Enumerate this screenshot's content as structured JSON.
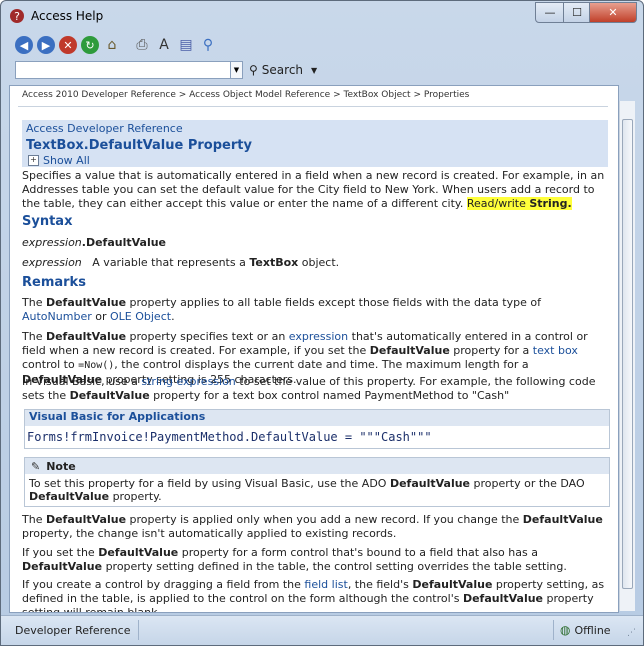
{
  "window": {
    "title": "Access Help",
    "min_glyph": "—",
    "max_glyph": "☐",
    "close_glyph": "✕"
  },
  "toolbar": {
    "buttons": [
      {
        "name": "back-button",
        "glyph": "◀",
        "color": "#3b6fc1"
      },
      {
        "name": "forward-button",
        "glyph": "▶",
        "color": "#3b6fc1"
      },
      {
        "name": "stop-button",
        "glyph": "✕",
        "color": "#c0392b"
      },
      {
        "name": "refresh-button",
        "glyph": "↻",
        "color": "#2e9b3c"
      },
      {
        "name": "home-button",
        "glyph": "⌂",
        "color": "#6a5a2e"
      },
      {
        "name": "print-button",
        "glyph": "⎙",
        "color": "#555555"
      },
      {
        "name": "font-size-button",
        "glyph": "A",
        "color": "#333333"
      },
      {
        "name": "table-of-contents-button",
        "glyph": "▤",
        "color": "#4b5fa8"
      },
      {
        "name": "pin-button",
        "glyph": "⚲",
        "color": "#3b6fc1"
      }
    ]
  },
  "search": {
    "value": "",
    "button_label": "Search"
  },
  "breadcrumb": "Access 2010 Developer Reference > Access Object Model Reference > TextBox Object > Properties",
  "header": {
    "reference": "Access Developer Reference",
    "title": "TextBox.DefaultValue Property",
    "show_all": "Show All"
  },
  "intro": {
    "text": "Specifies a value that is automatically entered in a field when a new record is created. For example, in an Addresses table you can set the default value for the City field to New York. When users add a record to the table, they can either accept this value or enter the name of a different city.",
    "rw_prefix": "Read/write",
    "rw_type": "String."
  },
  "syntax": {
    "heading": "Syntax",
    "expr_italic": "expression",
    "expr_bold": ".DefaultValue",
    "param_name": "expression",
    "param_desc_prefix": "A variable that represents a",
    "param_desc_bold": "TextBox",
    "param_desc_suffix": "object."
  },
  "remarks": {
    "heading": "Remarks",
    "p1": {
      "a": "The",
      "b": "DefaultValue",
      "c": "property applies to all table fields except those fields with the data type of",
      "link1": "AutoNumber",
      "d": "or",
      "link2": "OLE Object",
      "e": "."
    },
    "p2": {
      "a": "The",
      "b": "DefaultValue",
      "c": "property specifies text or an",
      "link1": "expression",
      "d": "that's automatically entered in a control or field when a new record is created. For example, if you set the",
      "e": "DefaultValue",
      "f": "property for a",
      "link2": "text box",
      "g": "control to",
      "code": "=Now()",
      "h": ", the control displays the current date and time. The maximum length for a",
      "i": "DefaultValue",
      "j": "property setting is 255 characters."
    },
    "p3": {
      "a": "In Visual Basic, use a",
      "link1": "string expression",
      "b": "to set the value of this property. For example, the following code sets the",
      "c": "DefaultValue",
      "d": "property for a text box control named PaymentMethod to \"Cash\""
    },
    "code_caption": "Visual Basic for Applications",
    "code": "Forms!frmInvoice!PaymentMethod.DefaultValue = \"\"\"Cash\"\"\"",
    "note_caption": "Note",
    "note": {
      "a": "To set this property for a field by using Visual Basic, use the ADO",
      "b": "DefaultValue",
      "c": "property or the DAO",
      "d": "DefaultValue",
      "e": "property."
    },
    "p4": {
      "a": "The",
      "b": "DefaultValue",
      "c": "property is applied only when you add a new record. If you change the",
      "d": "DefaultValue",
      "e": "property, the change isn't automatically applied to existing records."
    },
    "p5": {
      "a": "If you set the",
      "b": "DefaultValue",
      "c": "property for a form control that's bound to a field that also has a",
      "d": "DefaultValue",
      "e": "property setting defined in the table, the control setting overrides the table setting."
    },
    "p6": {
      "a": "If you create a control by dragging a field from the",
      "link1": "field list",
      "b": ", the field's",
      "c": "DefaultValue",
      "d": "property setting, as defined in the table, is applied to the control on the form although the control's",
      "e": "DefaultValue",
      "f": "property setting will remain blank."
    }
  },
  "status": {
    "left": "Developer Reference",
    "right": "Offline"
  }
}
